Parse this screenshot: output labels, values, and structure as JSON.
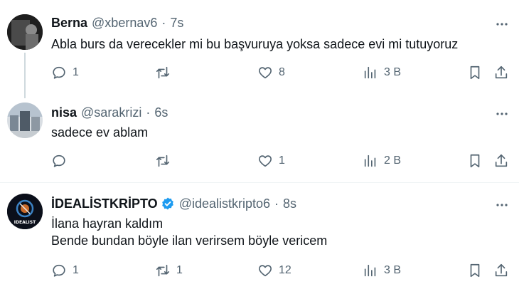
{
  "tweets": [
    {
      "name": "Berna",
      "handle": "@xbernav6",
      "sep": "·",
      "time": "7s",
      "lines": [
        "Abla burs da verecekler mi bu başvuruya yoksa sadece evi mi tutuyoruz"
      ],
      "reply_count": "1",
      "retweet_count": "",
      "like_count": "8",
      "views": "3 B"
    },
    {
      "name": "nisa",
      "handle": "@sarakrizi",
      "sep": "·",
      "time": "6s",
      "lines": [
        "sadece ev ablam"
      ],
      "reply_count": "",
      "retweet_count": "",
      "like_count": "1",
      "views": "2 B"
    },
    {
      "name": "İDEALİSTKRİPTO",
      "handle": "@idealistkripto6",
      "sep": "·",
      "time": "8s",
      "lines": [
        "İlana hayran kaldım",
        "Bende bundan böyle ilan verirsem böyle vericem"
      ],
      "reply_count": "1",
      "retweet_count": "1",
      "like_count": "12",
      "views": "3 B",
      "avatar_text": "IDEALIST"
    }
  ],
  "colors": {
    "text": "#0f1419",
    "muted": "#536471",
    "verified": "#1d9bf0",
    "thread": "#cfd9de"
  },
  "icons": [
    "reply-icon",
    "retweet-icon",
    "like-icon",
    "views-icon",
    "bookmark-icon",
    "share-icon",
    "more-icon",
    "verified-badge-icon"
  ]
}
